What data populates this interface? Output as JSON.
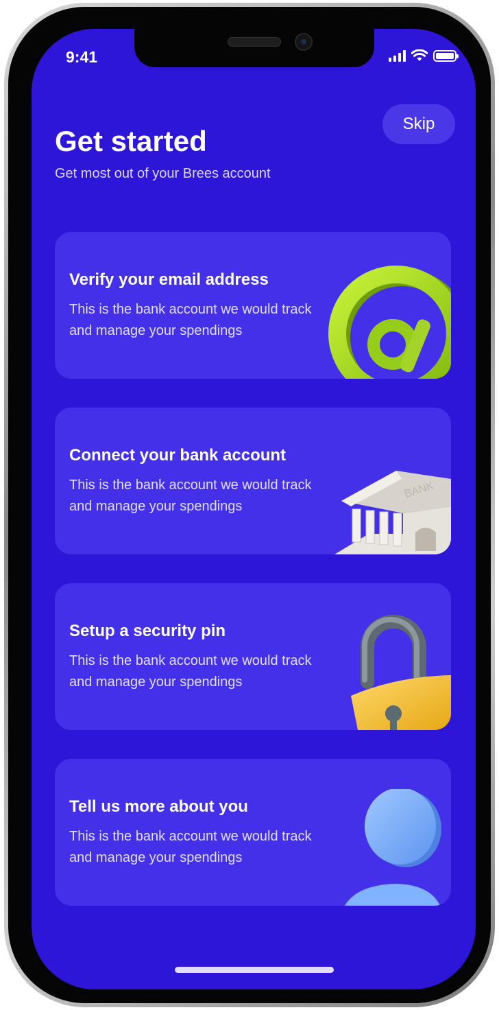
{
  "status_bar": {
    "time": "9:41"
  },
  "header": {
    "skip_label": "Skip",
    "title": "Get started",
    "subtitle": "Get most out of your Brees account"
  },
  "cards": [
    {
      "title": "Verify your email address",
      "description": "This is the bank account we would track and manage your spendings",
      "icon": "at-sign-icon"
    },
    {
      "title": "Connect your bank account",
      "description": "This is the bank account we would track and manage your spendings",
      "icon": "bank-icon",
      "icon_text": "BANK"
    },
    {
      "title": "Setup a security pin",
      "description": "This is the bank account we would track and manage your spendings",
      "icon": "padlock-icon"
    },
    {
      "title": "Tell us more about you",
      "description": "This is the bank account we would track and manage your spendings",
      "icon": "user-icon"
    }
  ],
  "colors": {
    "background": "#2e16d8",
    "card": "#4430e8",
    "skip_button": "#4a38e8",
    "text": "#ffffff"
  }
}
